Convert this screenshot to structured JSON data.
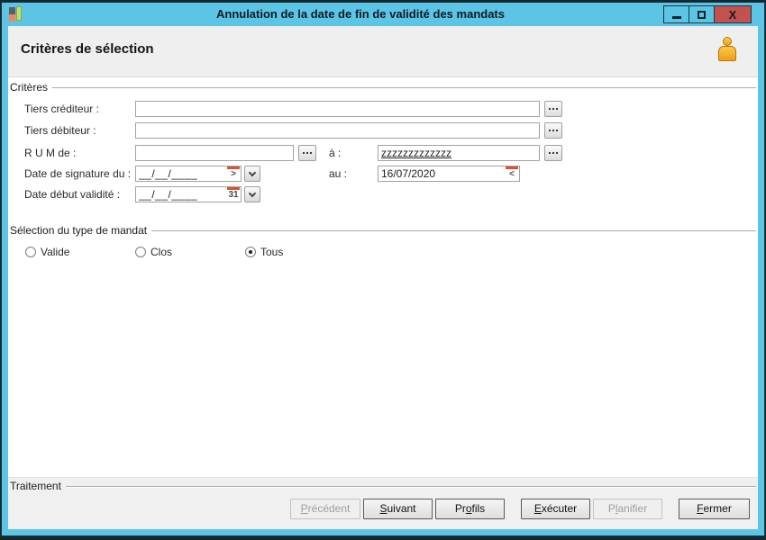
{
  "window": {
    "title": "Annulation de la date de fin de validité des mandats",
    "close_glyph": "X"
  },
  "header": {
    "title": "Critères de sélection"
  },
  "criteria": {
    "group_label": "Critères",
    "tiers_crediteur": {
      "label": "Tiers créditeur :",
      "value": ""
    },
    "tiers_debiteur": {
      "label": "Tiers débiteur :",
      "value": ""
    },
    "rum": {
      "label": "R U M de  :",
      "from_value": "",
      "to_label": "à :",
      "to_value": "zzzzzzzzzzzzz"
    },
    "date_signature": {
      "label": "Date de signature du :",
      "from_value": "__/__/____",
      "to_label": "au :",
      "to_value": "16/07/2020"
    },
    "date_debut_validite": {
      "label": "Date début validité :",
      "value": "__/__/____"
    },
    "calendar_from_glyph": ">",
    "calendar_to_glyph": "<",
    "calendar_day_icon_text": "31"
  },
  "mandate_type": {
    "group_label": "Sélection du type de mandat",
    "options": [
      {
        "label": "Valide",
        "selected": false
      },
      {
        "label": "Clos",
        "selected": false
      },
      {
        "label": "Tous",
        "selected": true
      }
    ]
  },
  "footer": {
    "group_label": "Traitement",
    "buttons": [
      {
        "pre": "",
        "key": "P",
        "post": "récédent",
        "disabled": true
      },
      {
        "pre": "",
        "key": "S",
        "post": "uivant",
        "disabled": false
      },
      {
        "pre": "Pr",
        "key": "o",
        "post": "fils",
        "disabled": false
      },
      {
        "pre": "",
        "key": "E",
        "post": "xécuter",
        "disabled": false
      },
      {
        "pre": "P",
        "key": "l",
        "post": "anifier",
        "disabled": true
      },
      {
        "pre": "",
        "key": "F",
        "post": "ermer",
        "disabled": false
      }
    ]
  },
  "colors": {
    "titlebar": "#5cc4e4",
    "close_button": "#c4514e",
    "header_bg": "#efefef",
    "accent_orange": "#f0a428",
    "calendar_red": "#d9532e"
  }
}
